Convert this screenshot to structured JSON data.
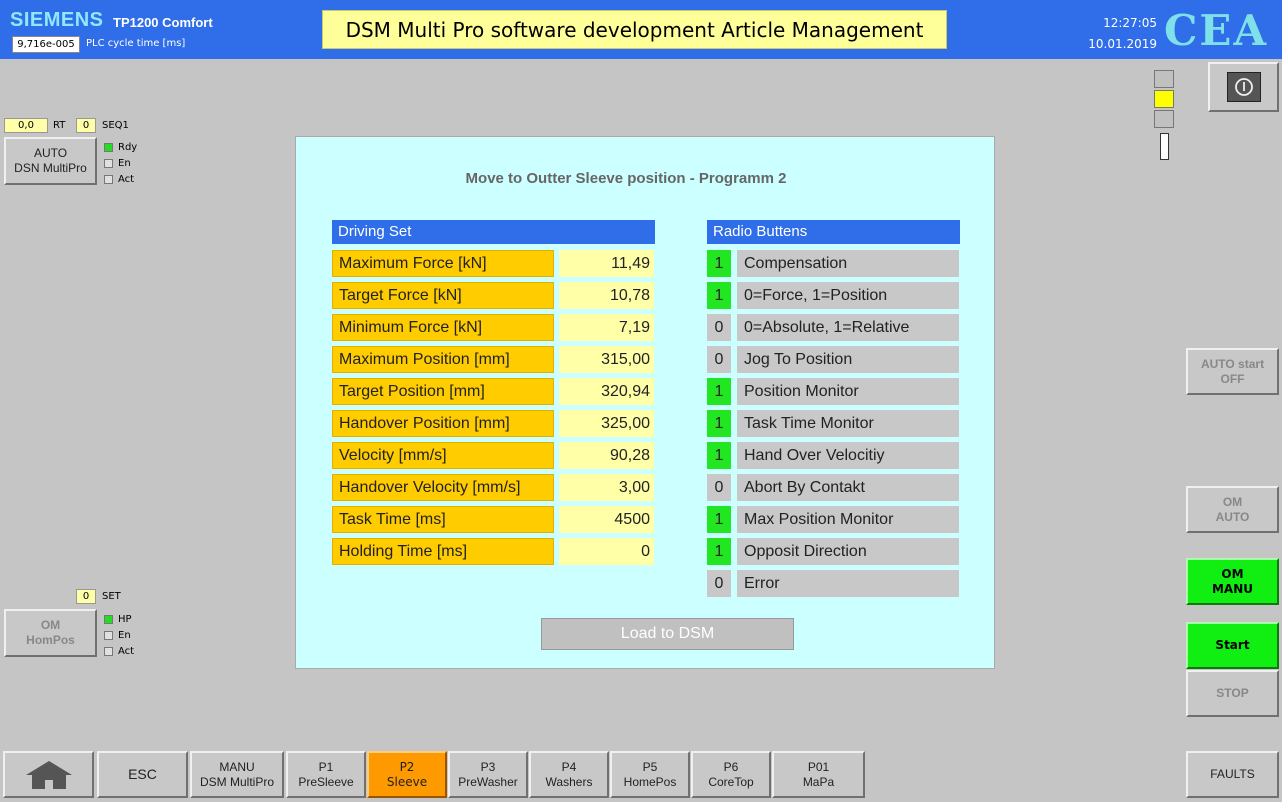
{
  "header": {
    "brand": "SIEMENS",
    "model": "TP1200 Comfort",
    "cycle_value": "9,716e-005",
    "cycle_label": "PLC cycle time [ms]",
    "title": "DSM Multi Pro software development Article Management",
    "time": "12:27:05",
    "date": "10.01.2019",
    "logo": "CEA"
  },
  "left_panel": {
    "rt_value": "0,0",
    "rt_label": "RT",
    "seq_value": "0",
    "seq_label": "SEQ1",
    "auto_button": {
      "line1": "AUTO",
      "line2": "DSN MultiPro"
    },
    "auto_status": [
      {
        "label": "Rdy",
        "on": true
      },
      {
        "label": "En",
        "on": false
      },
      {
        "label": "Act",
        "on": false
      }
    ],
    "set_value": "0",
    "set_label": "SET",
    "om_button": {
      "line1": "OM",
      "line2": "HomPos"
    },
    "om_status": [
      {
        "label": "HP",
        "on": true
      },
      {
        "label": "En",
        "on": false
      },
      {
        "label": "Act",
        "on": false
      }
    ]
  },
  "dialog": {
    "title": "Move to Outter Sleeve position - Programm 2",
    "driving_set_header": "Driving Set",
    "radio_header": "Radio Buttens",
    "params": [
      {
        "label": "Maximum Force [kN]",
        "value": "11,49"
      },
      {
        "label": "Target Force [kN]",
        "value": "10,78"
      },
      {
        "label": "Minimum Force [kN]",
        "value": "7,19"
      },
      {
        "label": "Maximum Position [mm]",
        "value": "315,00"
      },
      {
        "label": "Target Position [mm]",
        "value": "320,94"
      },
      {
        "label": "Handover Position [mm]",
        "value": "325,00"
      },
      {
        "label": "Velocity [mm/s]",
        "value": "90,28"
      },
      {
        "label": "Handover Velocity [mm/s]",
        "value": "3,00"
      },
      {
        "label": "Task Time [ms]",
        "value": "4500"
      },
      {
        "label": "Holding Time [ms]",
        "value": "0"
      }
    ],
    "radios": [
      {
        "flag": "1",
        "label": "Compensation"
      },
      {
        "flag": "1",
        "label": "0=Force, 1=Position"
      },
      {
        "flag": "0",
        "label": "0=Absolute, 1=Relative"
      },
      {
        "flag": "0",
        "label": "Jog To Position"
      },
      {
        "flag": "1",
        "label": "Position Monitor"
      },
      {
        "flag": "1",
        "label": "Task Time Monitor"
      },
      {
        "flag": "1",
        "label": "Hand Over Velocitiy"
      },
      {
        "flag": "0",
        "label": "Abort By Contakt"
      },
      {
        "flag": "1",
        "label": "Max Position Monitor"
      },
      {
        "flag": "1",
        "label": "Opposit Direction"
      },
      {
        "flag": "0",
        "label": "Error"
      }
    ],
    "load_button": "Load to DSM"
  },
  "right_panel": {
    "power_icon": "power-icon",
    "auto_start": {
      "line1": "AUTO start",
      "line2": "OFF"
    },
    "om_auto": {
      "line1": "OM",
      "line2": "AUTO"
    },
    "om_manu": {
      "line1": "OM",
      "line2": "MANU"
    },
    "start": "Start",
    "stop": "STOP",
    "faults": "FAULTS"
  },
  "nav": {
    "home_icon": "home-icon",
    "items": [
      {
        "line1": "ESC",
        "line2": ""
      },
      {
        "line1": "MANU",
        "line2": "DSM MultiPro"
      },
      {
        "line1": "P1",
        "line2": "PreSleeve"
      },
      {
        "line1": "P2",
        "line2": "Sleeve"
      },
      {
        "line1": "P3",
        "line2": "PreWasher"
      },
      {
        "line1": "P4",
        "line2": "Washers"
      },
      {
        "line1": "P5",
        "line2": "HomePos"
      },
      {
        "line1": "P6",
        "line2": "CoreTop"
      },
      {
        "line1": "P01",
        "line2": "MaPa"
      }
    ]
  },
  "colors": {
    "header": "#2f6ee8",
    "title_bg": "#ffff99",
    "dialog_bg": "#ccffff",
    "param_label": "#ffcc00",
    "param_value": "#ffffa8",
    "flag_on": "#22e622",
    "active_tab": "#ff9900",
    "green_button": "#11ee11"
  }
}
